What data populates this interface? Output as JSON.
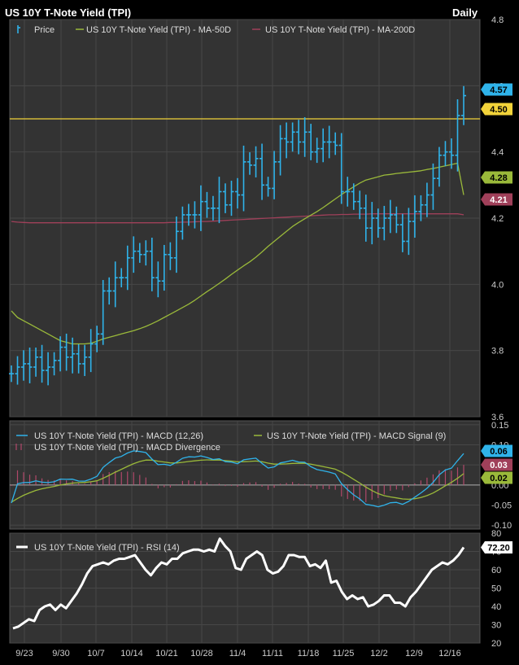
{
  "header": {
    "title": "US 10Y T-Note Yield (TPI)",
    "period": "Daily"
  },
  "colors": {
    "price": "#2fb3ea",
    "ma50": "#9ab93a",
    "ma200": "#a0405a",
    "resistance": "#f2d33a",
    "macd": "#2fb3ea",
    "signal": "#9ab93a",
    "divergence": "#b0486a",
    "rsi": "#ffffff",
    "panel_bg": "#333333",
    "grid": "#474747"
  },
  "x_labels": [
    "9/23",
    "9/30",
    "10/7",
    "10/14",
    "10/21",
    "10/28",
    "11/4",
    "11/11",
    "11/18",
    "11/25",
    "12/2",
    "12/9",
    "12/16"
  ],
  "chart_data": [
    {
      "type": "line",
      "panel": "price",
      "ylim": [
        3.6,
        4.8
      ],
      "yticks": [
        "3.6",
        "3.8",
        "4.0",
        "4.2",
        "4.4",
        "4.6",
        "4.8"
      ],
      "legend": [
        {
          "name": "Price"
        },
        {
          "name": "US 10Y T-Note Yield (TPI) - MA-50D"
        },
        {
          "name": "US 10Y T-Note Yield (TPI) - MA-200D"
        }
      ],
      "price": [
        3.73,
        3.75,
        3.76,
        3.75,
        3.78,
        3.74,
        3.75,
        3.77,
        3.81,
        3.78,
        3.79,
        3.76,
        3.78,
        3.82,
        3.85,
        3.98,
        3.98,
        4.02,
        4.02,
        4.08,
        4.1,
        4.09,
        4.1,
        4.02,
        4.01,
        4.09,
        4.08,
        4.16,
        4.21,
        4.21,
        4.21,
        4.25,
        4.23,
        4.23,
        4.28,
        4.24,
        4.28,
        4.27,
        4.37,
        4.36,
        4.38,
        4.3,
        4.29,
        4.37,
        4.44,
        4.43,
        4.46,
        4.43,
        4.46,
        4.4,
        4.41,
        4.43,
        4.43,
        4.42,
        4.28,
        4.28,
        4.25,
        4.23,
        4.17,
        4.2,
        4.17,
        4.2,
        4.21,
        4.18,
        4.13,
        4.19,
        4.22,
        4.24,
        4.27,
        4.32,
        4.39,
        4.4,
        4.39,
        4.51,
        4.57
      ],
      "ma50": [
        3.92,
        3.9,
        3.89,
        3.88,
        3.87,
        3.86,
        3.85,
        3.84,
        3.83,
        3.825,
        3.82,
        3.82,
        3.82,
        3.822,
        3.828,
        3.835,
        3.84,
        3.845,
        3.85,
        3.855,
        3.86,
        3.866,
        3.873,
        3.881,
        3.89,
        3.9,
        3.91,
        3.92,
        3.93,
        3.94,
        3.952,
        3.965,
        3.978,
        3.99,
        4.003,
        4.016,
        4.03,
        4.043,
        4.056,
        4.068,
        4.082,
        4.098,
        4.115,
        4.13,
        4.145,
        4.16,
        4.175,
        4.187,
        4.198,
        4.209,
        4.22,
        4.232,
        4.245,
        4.258,
        4.271,
        4.283,
        4.295,
        4.306,
        4.315,
        4.32,
        4.325,
        4.33,
        4.332,
        4.335,
        4.337,
        4.339,
        4.341,
        4.343,
        4.347,
        4.35,
        4.354,
        4.358,
        4.362,
        4.366,
        4.27
      ],
      "ma200": [
        4.19,
        4.188,
        4.187,
        4.186,
        4.186,
        4.186,
        4.186,
        4.186,
        4.186,
        4.186,
        4.186,
        4.186,
        4.186,
        4.186,
        4.186,
        4.186,
        4.186,
        4.186,
        4.186,
        4.186,
        4.186,
        4.186,
        4.186,
        4.186,
        4.186,
        4.186,
        4.187,
        4.187,
        4.188,
        4.188,
        4.189,
        4.19,
        4.19,
        4.191,
        4.192,
        4.193,
        4.194,
        4.195,
        4.196,
        4.197,
        4.198,
        4.199,
        4.2,
        4.201,
        4.202,
        4.203,
        4.204,
        4.205,
        4.206,
        4.207,
        4.208,
        4.209,
        4.21,
        4.21,
        4.211,
        4.211,
        4.212,
        4.212,
        4.212,
        4.213,
        4.213,
        4.213,
        4.213,
        4.213,
        4.213,
        4.213,
        4.213,
        4.213,
        4.213,
        4.213,
        4.213,
        4.213,
        4.213,
        4.213,
        4.21
      ],
      "resistance": 4.5,
      "labels": [
        {
          "value": 4.57,
          "text": "4.57",
          "color": "#2fb3ea"
        },
        {
          "value": 4.5,
          "text": "4.50",
          "color": "#f2d33a"
        },
        {
          "value": 4.28,
          "text": "4.28",
          "color": "#9ab93a"
        },
        {
          "value": 4.21,
          "text": "4.21",
          "color": "#a0405a"
        }
      ]
    },
    {
      "type": "line",
      "panel": "macd",
      "ylim": [
        -0.11,
        0.16
      ],
      "yticks": [
        "0.15",
        "0.10",
        "0.05",
        "0.00",
        "-0.05",
        "-0.10"
      ],
      "legend": [
        {
          "name": "US 10Y T-Note Yield (TPI) - MACD (12,26)"
        },
        {
          "name": "US 10Y T-Note Yield (TPI) - MACD Signal (9)"
        },
        {
          "name": "US 10Y T-Note Yield (TPI) - MACD Divergence"
        }
      ],
      "labels": [
        {
          "value": 0.06,
          "text": "0.06",
          "color": "#2fb3ea"
        },
        {
          "value": 0.03,
          "text": "0.03",
          "color": "#a0405a"
        },
        {
          "value": 0.02,
          "text": "0.02",
          "color": "#9ab93a"
        }
      ]
    },
    {
      "type": "line",
      "panel": "rsi",
      "ylim": [
        20,
        80
      ],
      "yticks": [
        "80",
        "70",
        "60",
        "50",
        "40",
        "30",
        "20"
      ],
      "legend": [
        {
          "name": "US 10Y T-Note Yield (TPI) - RSI (14)"
        }
      ],
      "rsi": [
        28,
        29,
        31,
        33,
        32,
        38,
        40,
        41,
        38,
        41,
        39,
        43,
        47,
        52,
        58,
        62,
        63,
        64,
        63,
        65,
        66,
        66,
        67,
        68,
        64,
        60,
        57,
        61,
        64,
        63,
        66,
        66,
        69,
        70,
        71,
        71,
        70,
        71,
        70,
        77,
        73,
        70,
        61,
        60,
        66,
        68,
        70,
        68,
        60,
        58,
        59,
        62,
        68,
        68,
        67,
        67,
        62,
        63,
        61,
        65,
        53,
        54,
        48,
        44,
        46,
        44,
        45,
        40,
        41,
        43,
        46,
        46,
        42,
        42,
        40,
        45,
        48,
        52,
        56,
        60,
        62,
        64,
        63,
        65,
        68,
        72.2
      ],
      "labels": [
        {
          "value": 72.2,
          "text": "72.20",
          "color": "#ffffff"
        }
      ]
    }
  ]
}
